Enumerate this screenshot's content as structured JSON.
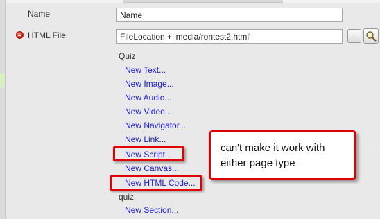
{
  "properties": {
    "name": {
      "label": "Name",
      "value": "Name"
    },
    "html_file": {
      "label": "HTML File",
      "value": "FileLocation + 'media/rontest2.html'",
      "browse_label": "..."
    }
  },
  "menu": {
    "group_quiz": "Quiz",
    "items": [
      "New Text...",
      "New Image...",
      "New Audio...",
      "New Video...",
      "New Navigator...",
      "New Link...",
      "New Script...",
      "New Canvas...",
      "New HTML Code..."
    ],
    "group_quiz_lower": "quiz",
    "section_item": "New Section..."
  },
  "annotation": {
    "text": "can't make it work with either page type",
    "color": "#e00000"
  }
}
